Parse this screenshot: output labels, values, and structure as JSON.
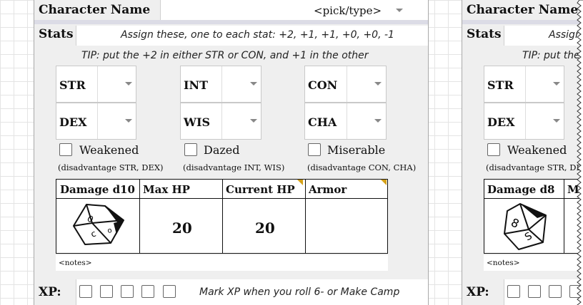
{
  "sheet1": {
    "character_name_label": "Character Name",
    "name_placeholder": "<pick/type>",
    "stats_label": "Stats",
    "stats_instruction": "Assign these, one to each stat: +2, +1, +1, +0, +0, -1",
    "tip": "TIP: put the +2 in either STR or CON, and +1 in the other",
    "stats": [
      "STR",
      "INT",
      "CON",
      "DEX",
      "WIS",
      "CHA"
    ],
    "conditions": [
      {
        "label": "Weakened",
        "note": "(disadvantage STR, DEX)"
      },
      {
        "label": "Dazed",
        "note": "(disadvantage INT, WIS)"
      },
      {
        "label": "Miserable",
        "note": "(disadvantage CON, CHA)"
      }
    ],
    "table_headers": [
      "Damage d10",
      "Max HP",
      "Current HP",
      "Armor"
    ],
    "max_hp": "20",
    "current_hp": "20",
    "notes_placeholder": "<notes>",
    "xp_label": "XP:",
    "xp_instruction": "Mark XP when you roll 6- or Make Camp"
  },
  "sheet2": {
    "character_name_label": "Character Name",
    "stats_label": "Stats",
    "stats_instruction_partial": "Assign",
    "tip_partial": "TIP: put the",
    "stats": [
      "STR",
      "DEX"
    ],
    "conditions": [
      {
        "label": "Weakened",
        "note": "(disadvantage STR, DE"
      }
    ],
    "table_headers": [
      "Damage d8",
      "M"
    ],
    "notes_placeholder": "<notes>",
    "xp_label": "XP:"
  },
  "icons": {
    "die1": "d10-die-icon",
    "die2": "d8-die-icon"
  },
  "colors": {
    "grid": "#e4e4e4",
    "panel": "#efefef",
    "note_corner": "#d4a017"
  }
}
